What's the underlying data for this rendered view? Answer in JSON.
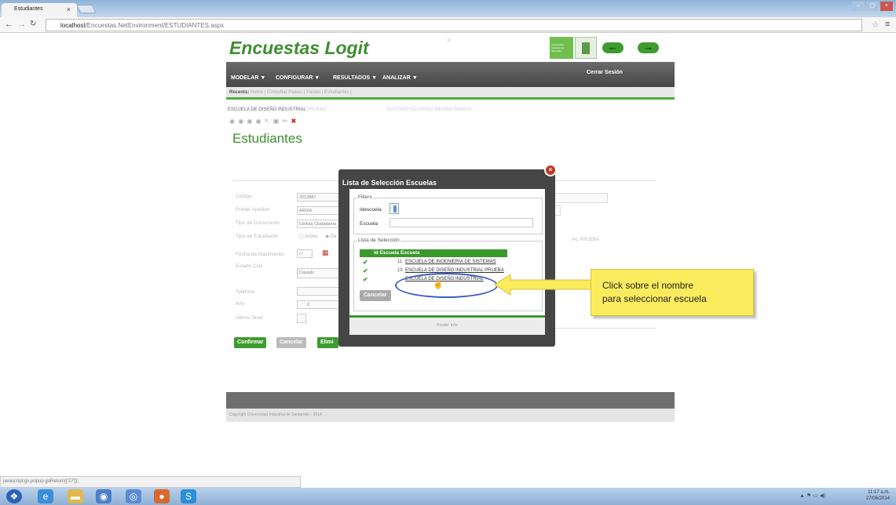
{
  "browser": {
    "tab_title": "Estudiantes",
    "tab_close": "×",
    "url_host": "localhost",
    "url_path": "/Encuestas.NetEnvironment/ESTUDIANTES.aspx",
    "status_text": "javascript:gs.popup.goReturn(['27']);"
  },
  "app": {
    "logo_text": "Encuestas Logit",
    "loading_glyph": "☼",
    "uni_logo_text": "Universidad Industrial de Santander",
    "back_arrow": "←",
    "forward_arrow": "→",
    "menu": [
      {
        "label": "MODELAR ▼"
      },
      {
        "label": "CONFIGURAR ▼"
      },
      {
        "label": "RESULTADOS ▼"
      },
      {
        "label": "ANALIZAR ▼"
      }
    ],
    "logout": "Cerrar Sesión",
    "recent_label": "Recents:",
    "recent_links": "Home | Consultar Paises | Paises | Estudiantes |",
    "context_school": "ESCUELA DE DISEÑO INDUSTRIAL",
    "context_school_extra": "PRUEBA",
    "context_user": "GUSTAVO EDUARDO MEDINA RAMOS",
    "toolbar_icons": "◉ ◉ ◉ ◉ ↖ ▣ ✏",
    "toolbar_delete": "✖",
    "page_title": "Estudiantes",
    "copyright": "Copyright Universidad Industrial de Santander - 2014"
  },
  "form": {
    "codigo_label": "Código",
    "codigo_value": "2012887",
    "apellido_label": "Primer Apellido",
    "apellido_value": "ARIZA",
    "tipodoc_label": "Tipo de Documento",
    "tipodoc_value": "Cédula Ciudadanía",
    "tipoest_label": "Tipo de Estudiante",
    "tipoest_option1": "Activo",
    "tipoest_option2": "De",
    "fecha_label": "Fecha de Nacimiento",
    "fecha_value": "/ /",
    "estado_label": "Estado Civil",
    "estado_value": "Casado",
    "telefono_label": "Teléfono",
    "anio_label": "Año",
    "anio_value": "0",
    "ultimo_label": "Último Nivel",
    "right_text": "IAL PRUEBA",
    "confirm_btn": "Confirmar",
    "cancel_btn": "Cancelar",
    "delete_btn": "Elimi"
  },
  "modal": {
    "title": "Lista de Selección Escuelas",
    "close": "×",
    "filters_legend": "Filters",
    "id_label": "Idescuela",
    "escuela_label": "Escuela",
    "list_legend": "Lista de Selección",
    "col_id": "Id Escuela",
    "col_name": "Escuela",
    "rows": [
      {
        "check": "✔",
        "id": "11",
        "name": "ESCUELA DE INGENIERIA DE SISTEMAS"
      },
      {
        "check": "✔",
        "id": "19",
        "name": "ESCUELA DE DISEÑO INDUSTRIAL PRUEBA"
      },
      {
        "check": "✔",
        "id": "",
        "name": "ESCUELA DE DISEÑO INDUSTRIAL"
      }
    ],
    "cancel": "Cancelar",
    "footer": "Footer Info"
  },
  "callout": {
    "line1": "Click sobre el nombre",
    "line2": "para seleccionar escuela"
  },
  "taskbar": {
    "time": "11:17 a.m.",
    "date": "27/06/2014",
    "tray": "▲ ⚑ ▭ ◀)"
  },
  "colors": {
    "brand_green": "#3e8e2f",
    "menu_gray": "#464646",
    "callout_yellow": "#fbec5d",
    "highlight_blue": "#3a5fc4"
  }
}
